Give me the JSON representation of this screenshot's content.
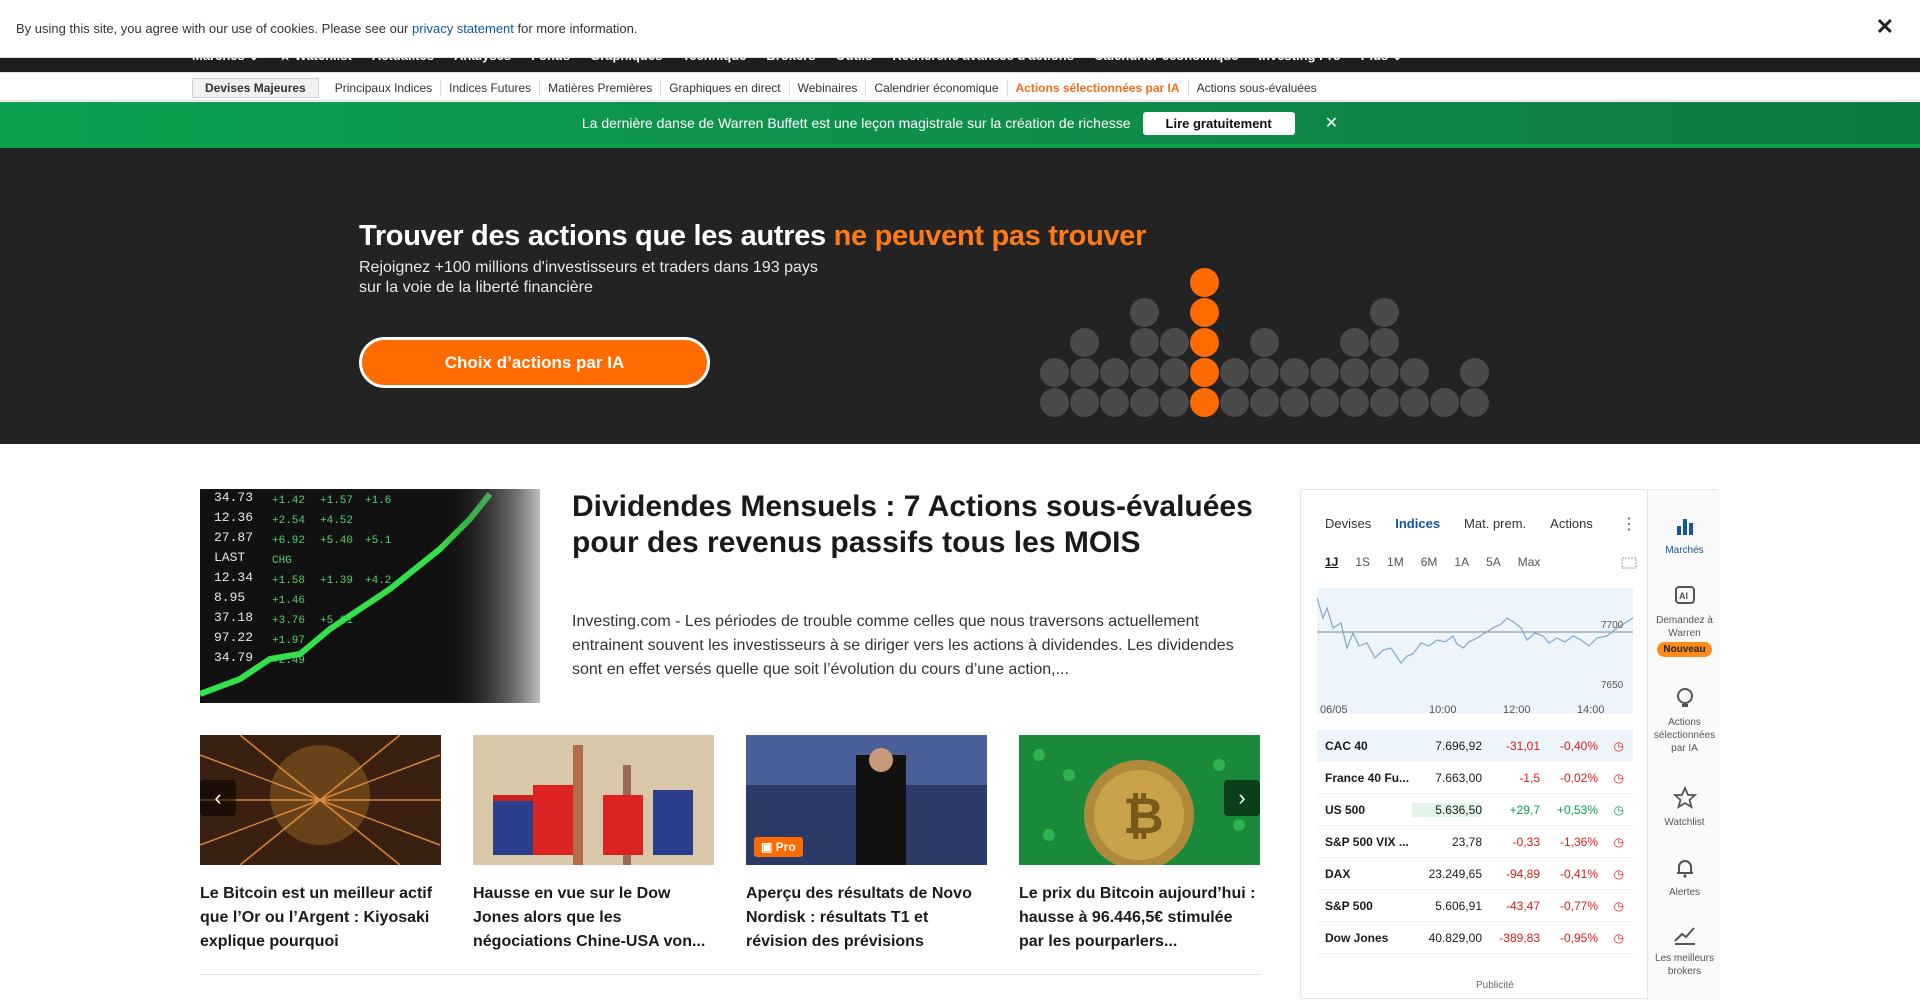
{
  "cookie": {
    "text_before": "By using this site, you agree with our use of cookies. Please see our",
    "link": "privacy statement",
    "text_after": "for more information.",
    "close": "✕"
  },
  "topnav": {
    "items": [
      "Marchés ⌄",
      "★ Watchlist",
      "Actualités",
      "Analyses",
      "Fonds",
      "Graphiques",
      "Technique",
      "Brokers",
      "Outils",
      "Recherche avancée d'actions",
      "Calendrier économique",
      "Investing Pro",
      "Plus ⌄"
    ]
  },
  "subnav": {
    "items": [
      "Devises Majeures",
      "Principaux Indices",
      "Indices Futures",
      "Matières Premières",
      "Graphiques en direct",
      "Webinaires",
      "Calendrier économique",
      "Actions sélectionnées par IA",
      "Actions sous-évaluées"
    ]
  },
  "promo": {
    "text": " La dernière danse de Warren Buffett est une leçon magistrale sur la création de richesse",
    "button": "Lire gratuitement",
    "close": "✕"
  },
  "hero": {
    "title_white": "Trouver des actions que les autres",
    "title_orange": "ne peuvent pas trouver",
    "sub1": "Rejoignez +100 millions d'investisseurs et traders dans 193 pays",
    "sub2": "sur la voie de la liberté financière",
    "cta": "Choix d’actions par IA"
  },
  "featured": {
    "title": "Dividendes Mensuels : 7 Actions sous-évaluées pour des revenus passifs tous les MOIS",
    "desc": "Investing.com - Les périodes de trouble comme celles que nous traversons actuellement entrainent souvent les investisseurs à se diriger vers les actions à dividendes. Les dividendes sont en effet versés quelle que soit l’évolution du cours d’une action,..."
  },
  "cards": [
    {
      "title": "Le Bitcoin est un meilleur actif que l’Or ou l’Argent : Kiyosaki explique pourquoi"
    },
    {
      "title": "Hausse en vue sur le Dow Jones alors que les négociations Chine-USA von..."
    },
    {
      "title": "Aperçu des résultats de Novo Nordisk : résultats T1 et révision des prévisions",
      "badge": "Pro"
    },
    {
      "title": "Le prix du Bitcoin aujourd’hui : hausse à 96.446,5€ stimulée par les pourparlers..."
    }
  ],
  "widget": {
    "tabs": [
      "Devises",
      "Indices",
      "Mat. prem.",
      "Actions"
    ],
    "ranges": [
      "1J",
      "1S",
      "1M",
      "6M",
      "1A",
      "5A",
      "Max"
    ],
    "y_labels": [
      "7700",
      "7650"
    ],
    "x_labels": [
      "06/05",
      "10:00",
      "12:00",
      "14:00"
    ],
    "rows": [
      {
        "name": "CAC 40",
        "price": "7.696,92",
        "chg": "-31,01",
        "pct": "-0,40%",
        "dir": "neg"
      },
      {
        "name": "France 40 Fu...",
        "price": "7.663,00",
        "chg": "-1,5",
        "pct": "-0,02%",
        "dir": "neg"
      },
      {
        "name": "US 500",
        "price": "5.636,50",
        "chg": "+29,7",
        "pct": "+0,53%",
        "dir": "pos"
      },
      {
        "name": "S&P 500 VIX ...",
        "price": "23,78",
        "chg": "-0,33",
        "pct": "-1,36%",
        "dir": "neg"
      },
      {
        "name": "DAX",
        "price": "23.249,65",
        "chg": "-94,89",
        "pct": "-0,41%",
        "dir": "neg"
      },
      {
        "name": "S&P 500",
        "price": "5.606,91",
        "chg": "-43,47",
        "pct": "-0,77%",
        "dir": "neg"
      },
      {
        "name": "Dow Jones",
        "price": "40.829,00",
        "chg": "-389,83",
        "pct": "-0,95%",
        "dir": "neg"
      }
    ],
    "pub": "Publicité"
  },
  "sidebar": {
    "markets": "Marchés",
    "warren": "Demandez à Warren",
    "warren_badge": "Nouveau",
    "ai": "Actions sélectionnées par IA",
    "watchlist": "Watchlist",
    "alerts": "Alertes",
    "brokers": "Les meilleurs brokers"
  },
  "colors": {
    "accent_orange": "#ff6b00",
    "promo_green": "#0aa150",
    "hero_bg": "#232323",
    "negative": "#d91e18",
    "positive": "#0aa150",
    "link_blue": "#1256a0"
  }
}
